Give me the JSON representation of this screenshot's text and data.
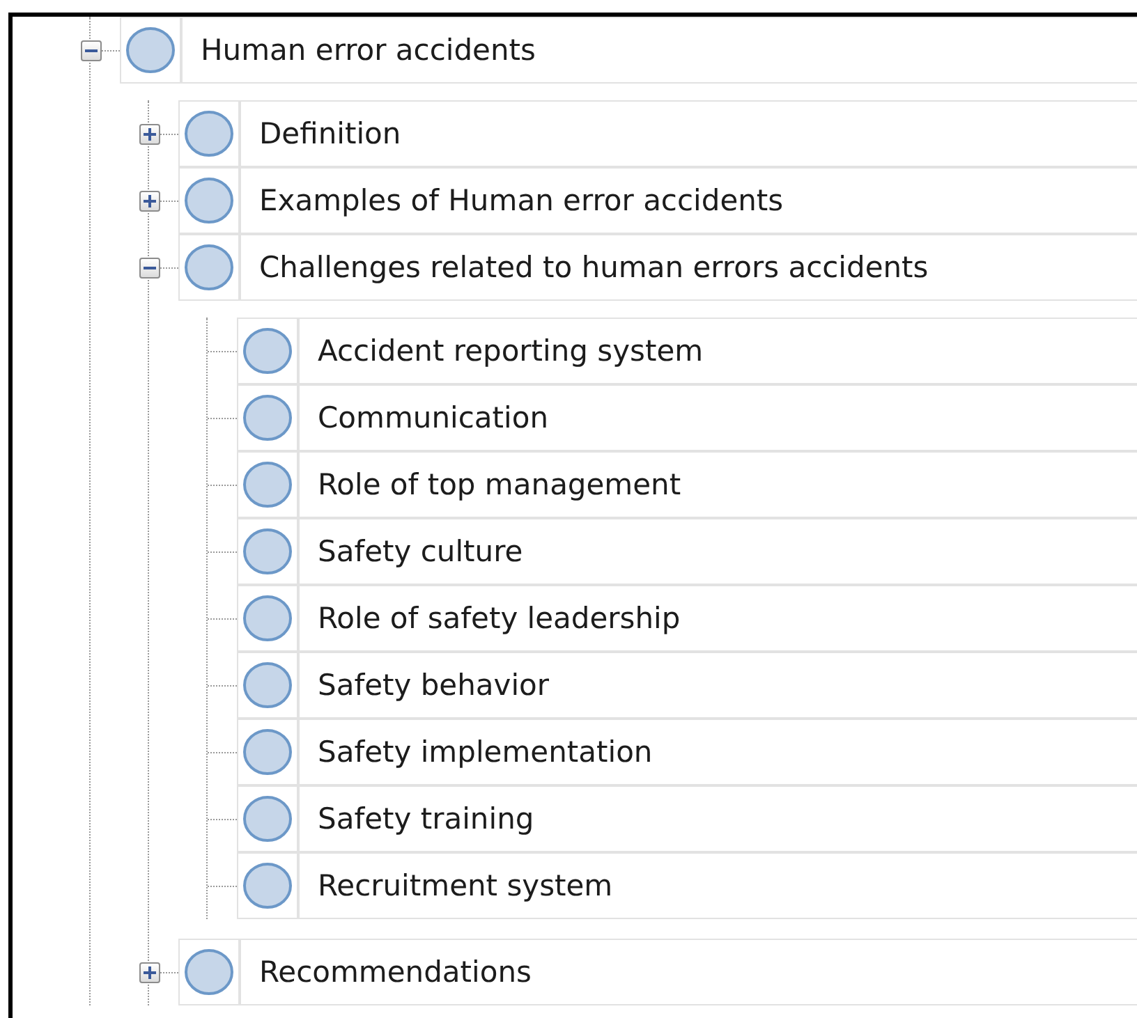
{
  "tree": [
    {
      "label": "Human error accidents",
      "expanded": true,
      "children": [
        {
          "label": "Definition",
          "expanded": false
        },
        {
          "label": "Examples of Human error accidents",
          "expanded": false
        },
        {
          "label": "Challenges related to human errors accidents",
          "expanded": true,
          "children": [
            {
              "label": "Accident reporting system"
            },
            {
              "label": "Communication"
            },
            {
              "label": "Role of top management"
            },
            {
              "label": "Safety culture"
            },
            {
              "label": "Role of safety leadership"
            },
            {
              "label": "Safety behavior"
            },
            {
              "label": "Safety implementation"
            },
            {
              "label": "Safety training"
            },
            {
              "label": "Recruitment system"
            }
          ]
        },
        {
          "label": "Recommendations",
          "expanded": false
        }
      ]
    }
  ]
}
